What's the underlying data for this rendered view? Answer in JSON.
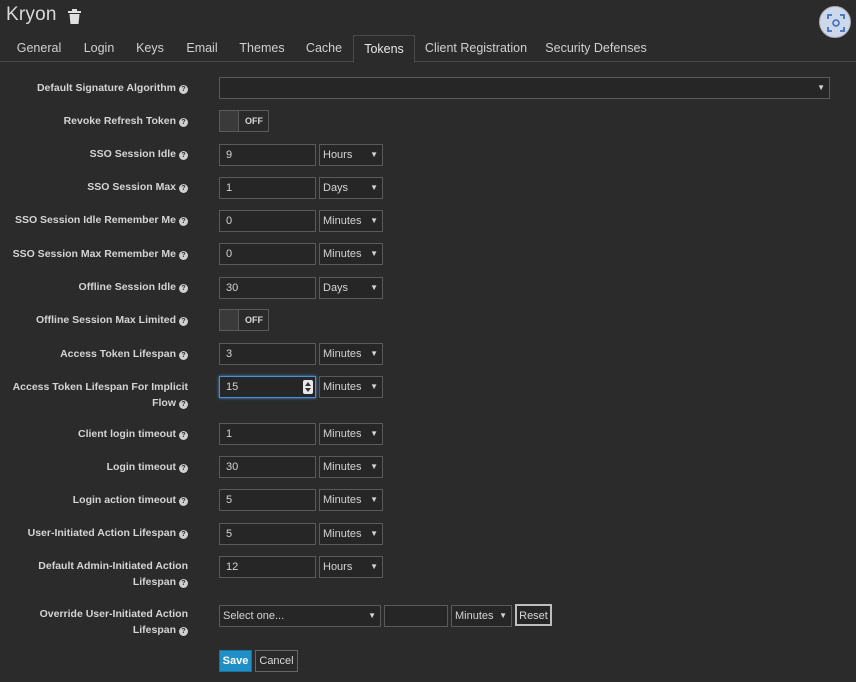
{
  "header": {
    "realm_name": "Kryon"
  },
  "tabs": [
    {
      "label": "General"
    },
    {
      "label": "Login"
    },
    {
      "label": "Keys"
    },
    {
      "label": "Email"
    },
    {
      "label": "Themes"
    },
    {
      "label": "Cache"
    },
    {
      "label": "Tokens",
      "active": true
    },
    {
      "label": "Client Registration"
    },
    {
      "label": "Security Defenses"
    }
  ],
  "form": {
    "default_signature_algorithm": {
      "label": "Default Signature Algorithm",
      "value": ""
    },
    "revoke_refresh_token": {
      "label": "Revoke Refresh Token",
      "state": "OFF"
    },
    "sso_session_idle": {
      "label": "SSO Session Idle",
      "value": "9",
      "unit": "Hours"
    },
    "sso_session_max": {
      "label": "SSO Session Max",
      "value": "1",
      "unit": "Days"
    },
    "sso_session_idle_remember_me": {
      "label": "SSO Session Idle Remember Me",
      "value": "0",
      "unit": "Minutes"
    },
    "sso_session_max_remember_me": {
      "label": "SSO Session Max Remember Me",
      "value": "0",
      "unit": "Minutes"
    },
    "offline_session_idle": {
      "label": "Offline Session Idle",
      "value": "30",
      "unit": "Days"
    },
    "offline_session_max_limited": {
      "label": "Offline Session Max Limited",
      "state": "OFF"
    },
    "access_token_lifespan": {
      "label": "Access Token Lifespan",
      "value": "3",
      "unit": "Minutes"
    },
    "access_token_lifespan_implicit": {
      "label_line1": "Access Token Lifespan For Implicit",
      "label_line2": "Flow",
      "value": "15",
      "unit": "Minutes"
    },
    "client_login_timeout": {
      "label": "Client login timeout",
      "value": "1",
      "unit": "Minutes"
    },
    "login_timeout": {
      "label": "Login timeout",
      "value": "30",
      "unit": "Minutes"
    },
    "login_action_timeout": {
      "label": "Login action timeout",
      "value": "5",
      "unit": "Minutes"
    },
    "user_initiated_action_lifespan": {
      "label": "User-Initiated Action Lifespan",
      "value": "5",
      "unit": "Minutes"
    },
    "default_admin_initiated_action_lifespan": {
      "label_line1": "Default Admin-Initiated Action",
      "label_line2": "Lifespan",
      "value": "12",
      "unit": "Hours"
    },
    "override_user_initiated_action_lifespan": {
      "label_line1": "Override User-Initiated Action",
      "label_line2": "Lifespan",
      "select_placeholder": "Select one...",
      "value": "",
      "unit": "Minutes",
      "reset_label": "Reset"
    }
  },
  "actions": {
    "save_label": "Save",
    "cancel_label": "Cancel"
  }
}
